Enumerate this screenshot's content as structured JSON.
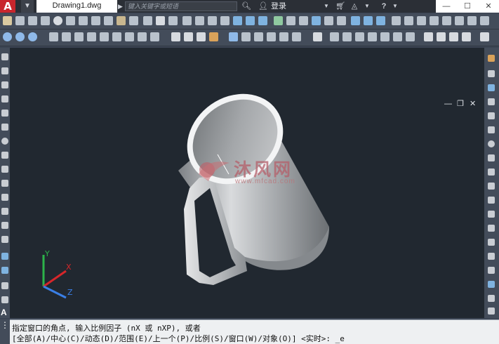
{
  "title_bar": {
    "app_logo": "A",
    "document_tab": "Drawing1.dwg",
    "search_placeholder": "键入关键字或短语",
    "login_label": "登录",
    "help_icon": "?"
  },
  "viewport": {
    "controls": [
      "—",
      "❐",
      "✕"
    ],
    "ucs_labels": {
      "x": "X",
      "y": "Y",
      "z": "Z"
    },
    "watermark_text": "沐风网",
    "watermark_url": "www.mfcad.com"
  },
  "command": {
    "line1": "指定窗口的角点, 输入比例因子 (nX 或 nXP), 或者",
    "line2": "[全部(A)/中心(C)/动态(D)/范围(E)/上一个(P)/比例(S)/窗口(W)/对象(O)] <实时>: _e"
  },
  "colors": {
    "canvas_bg": "#212830",
    "toolbar_bg": "#434c5a",
    "app_red": "#c8262d",
    "axis_x": "#d6262a",
    "axis_y": "#2cb34a",
    "axis_z": "#3a7fe6"
  }
}
